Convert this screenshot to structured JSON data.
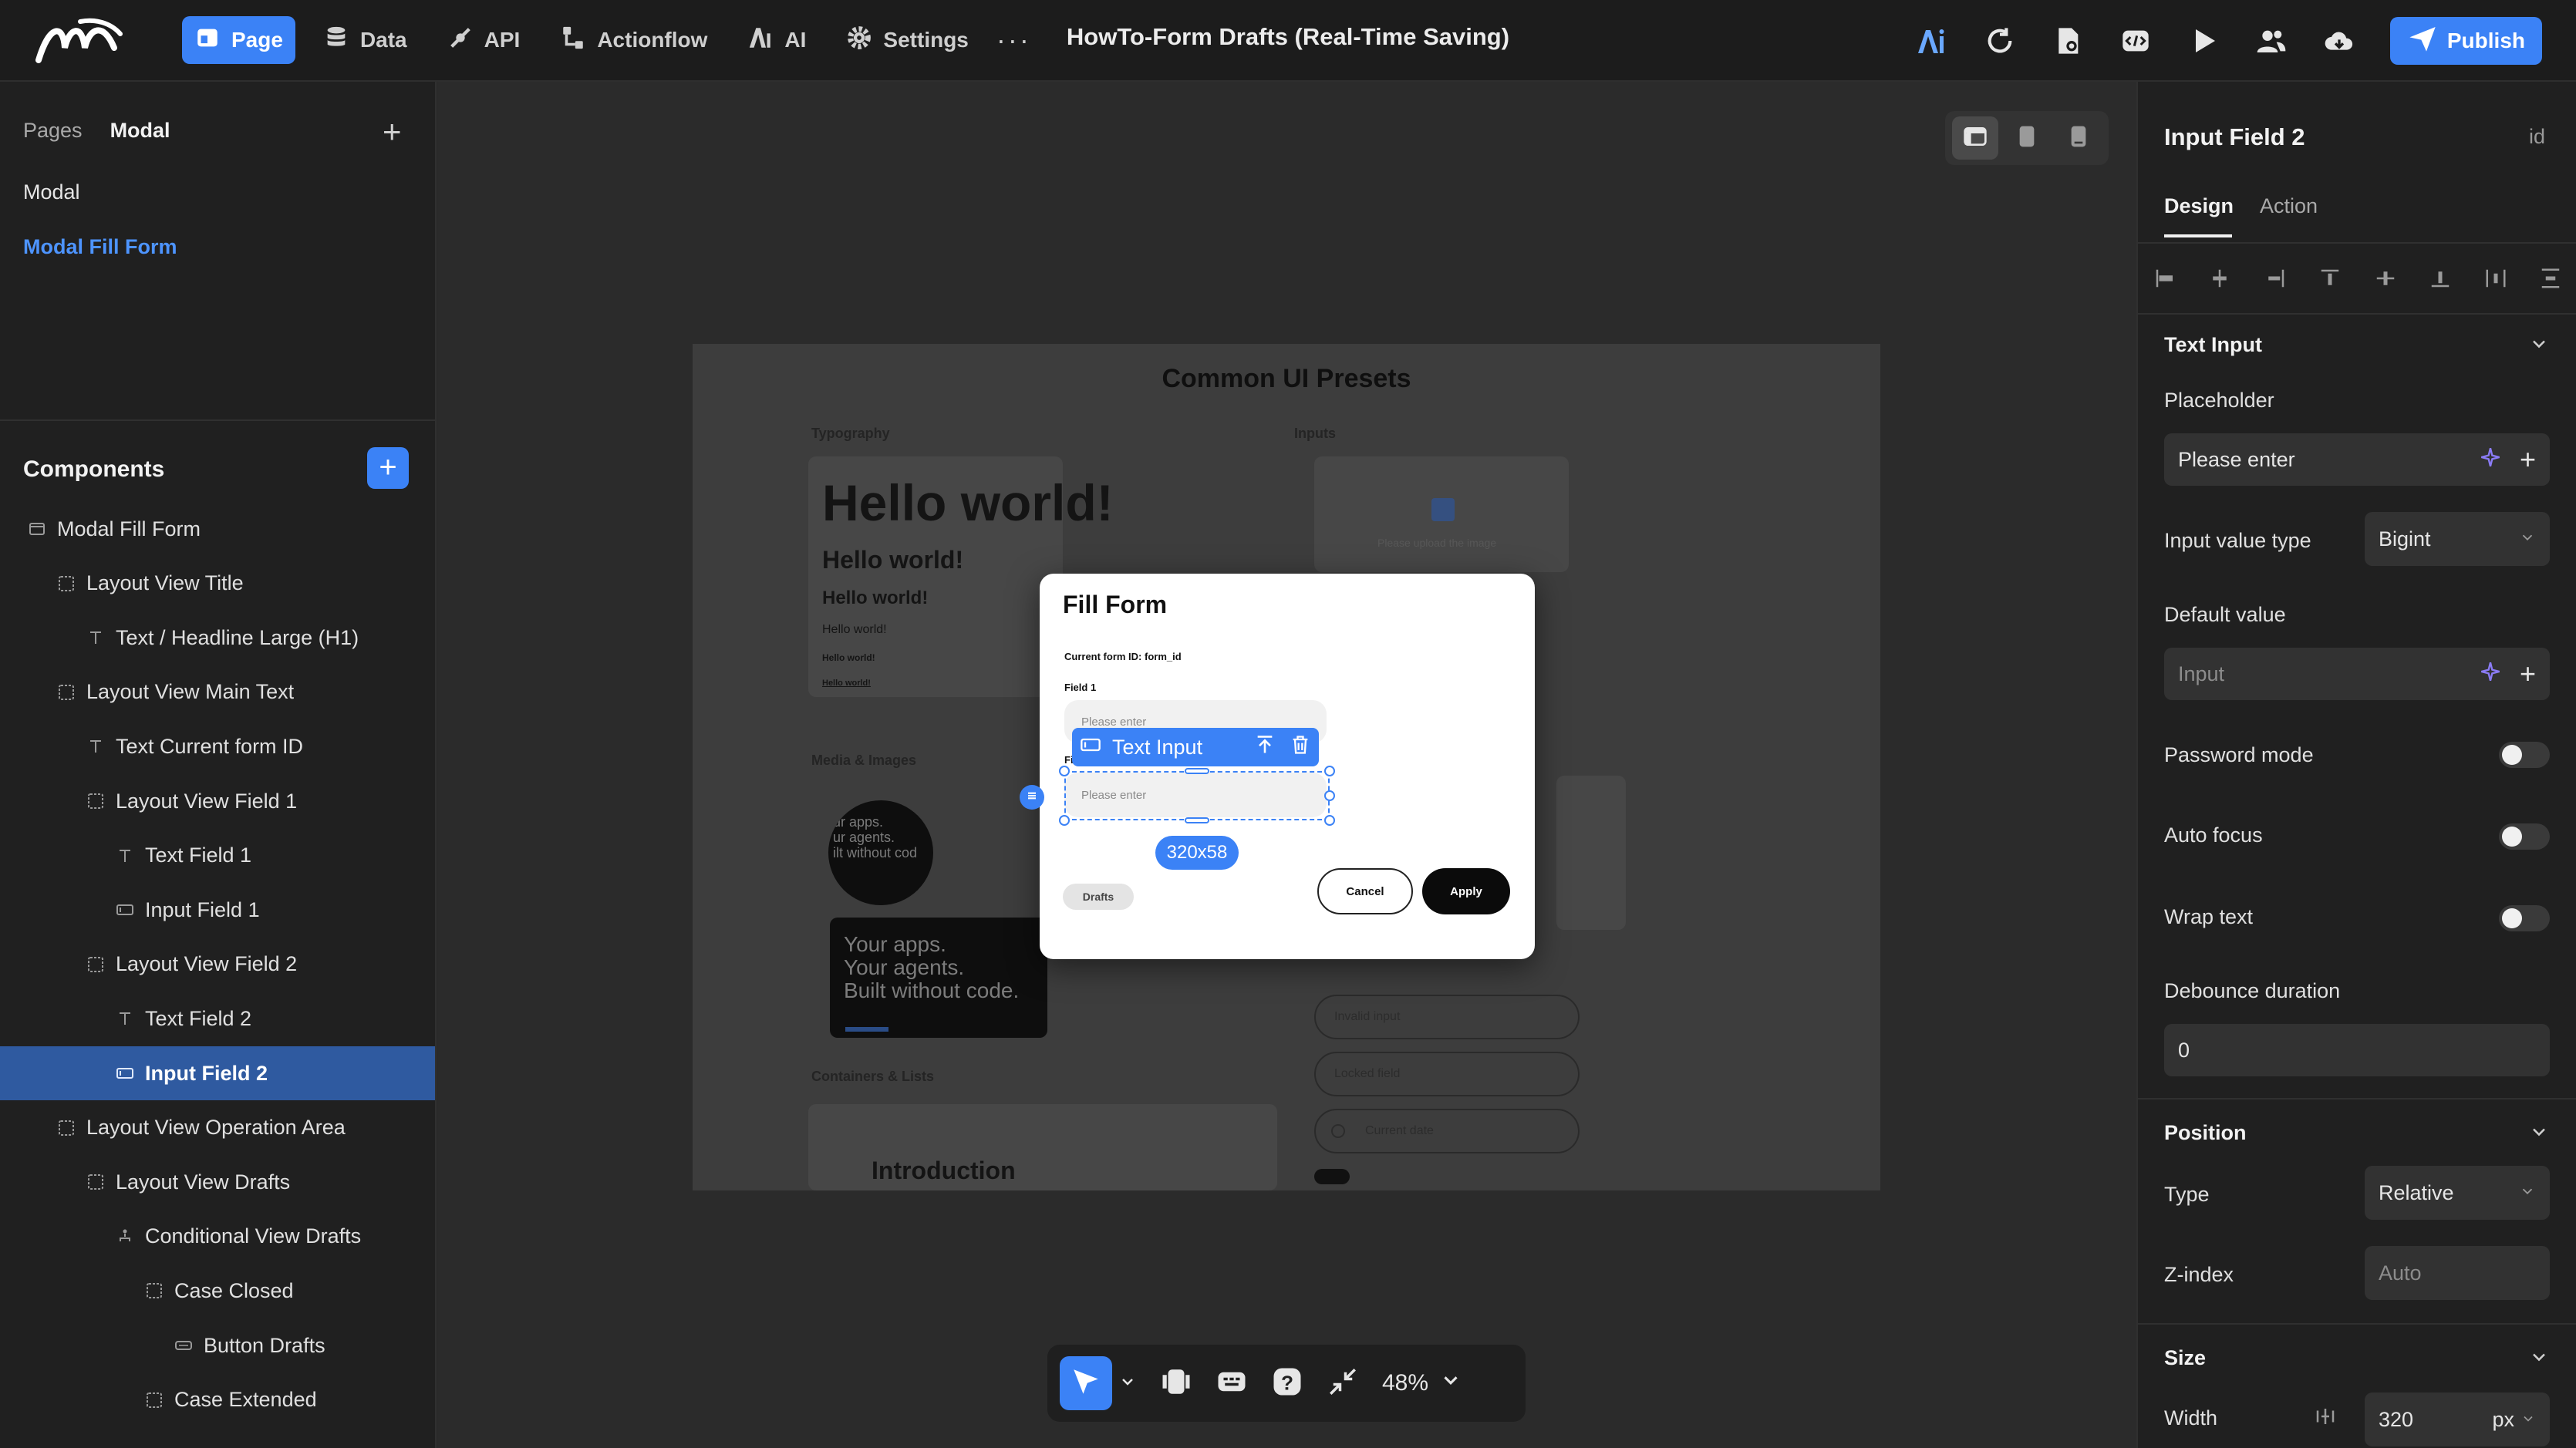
{
  "colors": {
    "accent": "#3b82f6",
    "bg_dark": "#1c1c1c",
    "panel": "#202020",
    "selected_row": "#2f5aa0"
  },
  "topbar": {
    "nav": [
      {
        "label": "Page",
        "icon": "page-icon",
        "active": true
      },
      {
        "label": "Data",
        "icon": "database-icon"
      },
      {
        "label": "API",
        "icon": "api-icon"
      },
      {
        "label": "Actionflow",
        "icon": "flow-icon"
      },
      {
        "label": "AI",
        "icon": "ai-icon"
      },
      {
        "label": "Settings",
        "icon": "gear-icon"
      }
    ],
    "more": "···",
    "title": "HowTo-Form Drafts (Real-Time Saving)",
    "publish_label": "Publish"
  },
  "left": {
    "pages_tab": "Pages",
    "modal_tab": "Modal",
    "pages": [
      "Modal",
      "Modal Fill Form"
    ],
    "components_title": "Components",
    "tree": [
      {
        "label": "Modal Fill Form",
        "icon": "modal-icon",
        "depth": 0
      },
      {
        "label": "Layout View Title",
        "icon": "layout-icon",
        "depth": 1
      },
      {
        "label": "Text / Headline Large (H1)",
        "icon": "text-icon",
        "depth": 2
      },
      {
        "label": "Layout View Main Text",
        "icon": "layout-icon",
        "depth": 1
      },
      {
        "label": "Text Current form ID",
        "icon": "text-icon",
        "depth": 2
      },
      {
        "label": "Layout View Field 1",
        "icon": "layout-icon",
        "depth": 2
      },
      {
        "label": "Text Field 1",
        "icon": "text-icon",
        "depth": 3
      },
      {
        "label": "Input Field 1",
        "icon": "input-icon",
        "depth": 3
      },
      {
        "label": "Layout View Field 2",
        "icon": "layout-icon",
        "depth": 2
      },
      {
        "label": "Text Field 2",
        "icon": "text-icon",
        "depth": 3
      },
      {
        "label": "Input Field 2",
        "icon": "input-icon",
        "depth": 3,
        "selected": true
      },
      {
        "label": "Layout View Operation Area",
        "icon": "layout-icon",
        "depth": 1
      },
      {
        "label": "Layout View Drafts",
        "icon": "layout-icon",
        "depth": 2
      },
      {
        "label": "Conditional View Drafts",
        "icon": "conditional-icon",
        "depth": 3
      },
      {
        "label": "Case Closed",
        "icon": "layout-icon",
        "depth": 4
      },
      {
        "label": "Button Drafts",
        "icon": "button-icon",
        "depth": 5
      },
      {
        "label": "Case Extended",
        "icon": "layout-icon",
        "depth": 4
      }
    ]
  },
  "canvas": {
    "artboard": {
      "title": "Common UI Presets",
      "typography_label": "Typography",
      "inputs_label": "Inputs",
      "media_label": "Media & Images",
      "containers_label": "Containers & Lists",
      "hello": "Hello world!",
      "upload_hint": "Please upload the image",
      "black_card_text": "Your apps.\nYour agents.\nBuilt without code.",
      "circle_text": "ur apps.\nur agents.\nilt without cod",
      "invalid_input": "Invalid input",
      "locked_field": "Locked field",
      "current_date": "Current date",
      "introduction": "Introduction"
    },
    "modal": {
      "title": "Fill Form",
      "form_id": "Current form ID: form_id",
      "field1_label": "Field 1",
      "field2_label": "Field 2",
      "placeholder": "Please enter",
      "drafts": "Drafts",
      "cancel": "Cancel",
      "apply": "Apply"
    },
    "selection": {
      "label": "Text Input",
      "size": "320x58"
    },
    "zoom": "48%"
  },
  "right": {
    "title": "Input Field 2",
    "id_label": "id",
    "tabs": [
      "Design",
      "Action"
    ],
    "section_text_input": "Text Input",
    "placeholder_label": "Placeholder",
    "placeholder_value": "Please enter",
    "input_value_type_label": "Input value type",
    "input_value_type": "Bigint",
    "default_value_label": "Default value",
    "default_value_placeholder": "Input",
    "password_mode_label": "Password mode",
    "auto_focus_label": "Auto focus",
    "wrap_text_label": "Wrap text",
    "debounce_label": "Debounce duration",
    "debounce_value": "0",
    "section_position": "Position",
    "type_label": "Type",
    "type_value": "Relative",
    "zindex_label": "Z-index",
    "zindex_placeholder": "Auto",
    "section_size": "Size",
    "width_label": "Width",
    "width_value": "320",
    "width_unit": "px"
  }
}
